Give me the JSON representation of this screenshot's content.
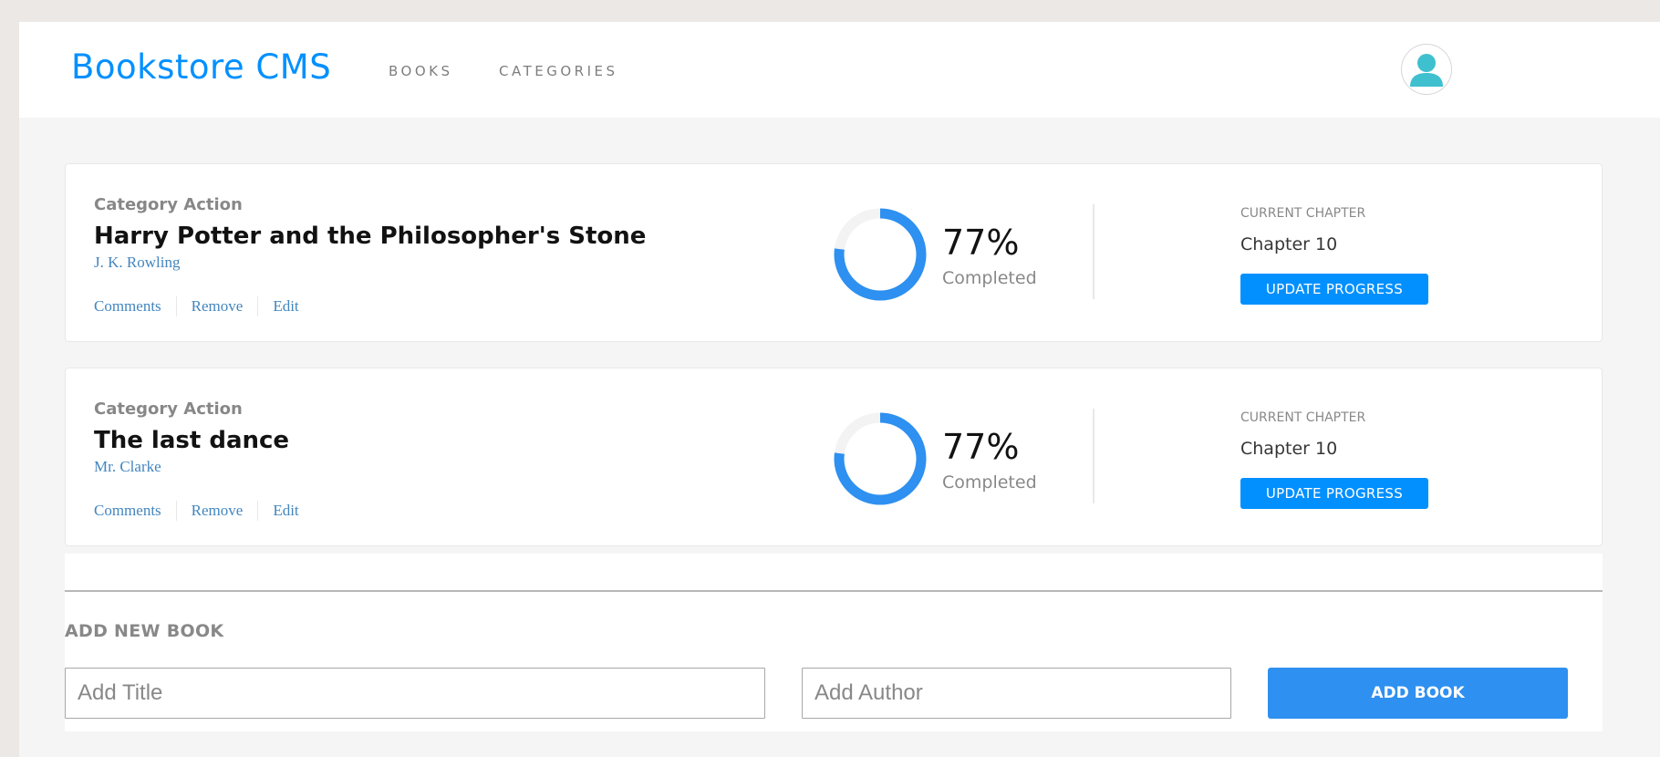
{
  "colors": {
    "accent": "#0290ff",
    "link": "#4386bf",
    "page_background": "#f6f5f5",
    "ring_track": "#e8e8e8"
  },
  "header": {
    "brand": "Bookstore CMS",
    "nav": [
      {
        "label": "BOOKS"
      },
      {
        "label": "CATEGORIES"
      }
    ],
    "avatar_icon": "user-icon"
  },
  "books": [
    {
      "category": "Category Action",
      "title": "Harry Potter and the Philosopher's Stone",
      "author": "J. K. Rowling",
      "actions": [
        "Comments",
        "Remove",
        "Edit"
      ],
      "progress_percent": 77,
      "percent_label": "77%",
      "completed_label": "Completed",
      "chapter_label": "CURRENT CHAPTER",
      "chapter": "Chapter 10",
      "update_label": "UPDATE PROGRESS"
    },
    {
      "category": "Category Action",
      "title": "The last dance",
      "author": "Mr. Clarke",
      "actions": [
        "Comments",
        "Remove",
        "Edit"
      ],
      "progress_percent": 77,
      "percent_label": "77%",
      "completed_label": "Completed",
      "chapter_label": "CURRENT CHAPTER",
      "chapter": "Chapter 10",
      "update_label": "UPDATE PROGRESS"
    }
  ],
  "add_form": {
    "heading": "ADD NEW BOOK",
    "title_placeholder": "Add Title",
    "title_value": "",
    "author_placeholder": "Add Author",
    "author_value": "",
    "submit_label": "ADD BOOK"
  }
}
